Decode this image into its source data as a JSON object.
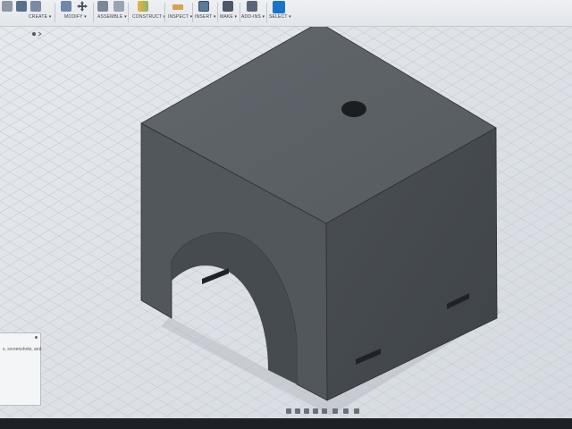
{
  "toolbar": {
    "groups": [
      {
        "label": "CREATE ▾"
      },
      {
        "label": "MODIFY ▾"
      },
      {
        "label": "ASSEMBLE ▾"
      },
      {
        "label": "CONSTRUCT ▾"
      },
      {
        "label": "INSPECT ▾"
      },
      {
        "label": "INSERT ▾"
      },
      {
        "label": "MAKE ▾"
      },
      {
        "label": "ADD-INS ▾"
      },
      {
        "label": "SELECT ▾"
      }
    ]
  },
  "panel": {
    "text": "s, screenshots, and"
  },
  "colors": {
    "accent": "#1a73c9",
    "body_top": "#5b6166",
    "body_left": "#4f5459",
    "body_right": "#44494e",
    "grid": "#c4cbd3"
  },
  "icons": {
    "create": "solid-box-icon",
    "modify": "move-arrows-icon",
    "assemble": "joint-icon",
    "construct": "plane-icon",
    "inspect": "measure-icon",
    "insert": "image-icon",
    "make": "print-icon",
    "addins": "plugin-icon",
    "select": "cursor-icon"
  }
}
